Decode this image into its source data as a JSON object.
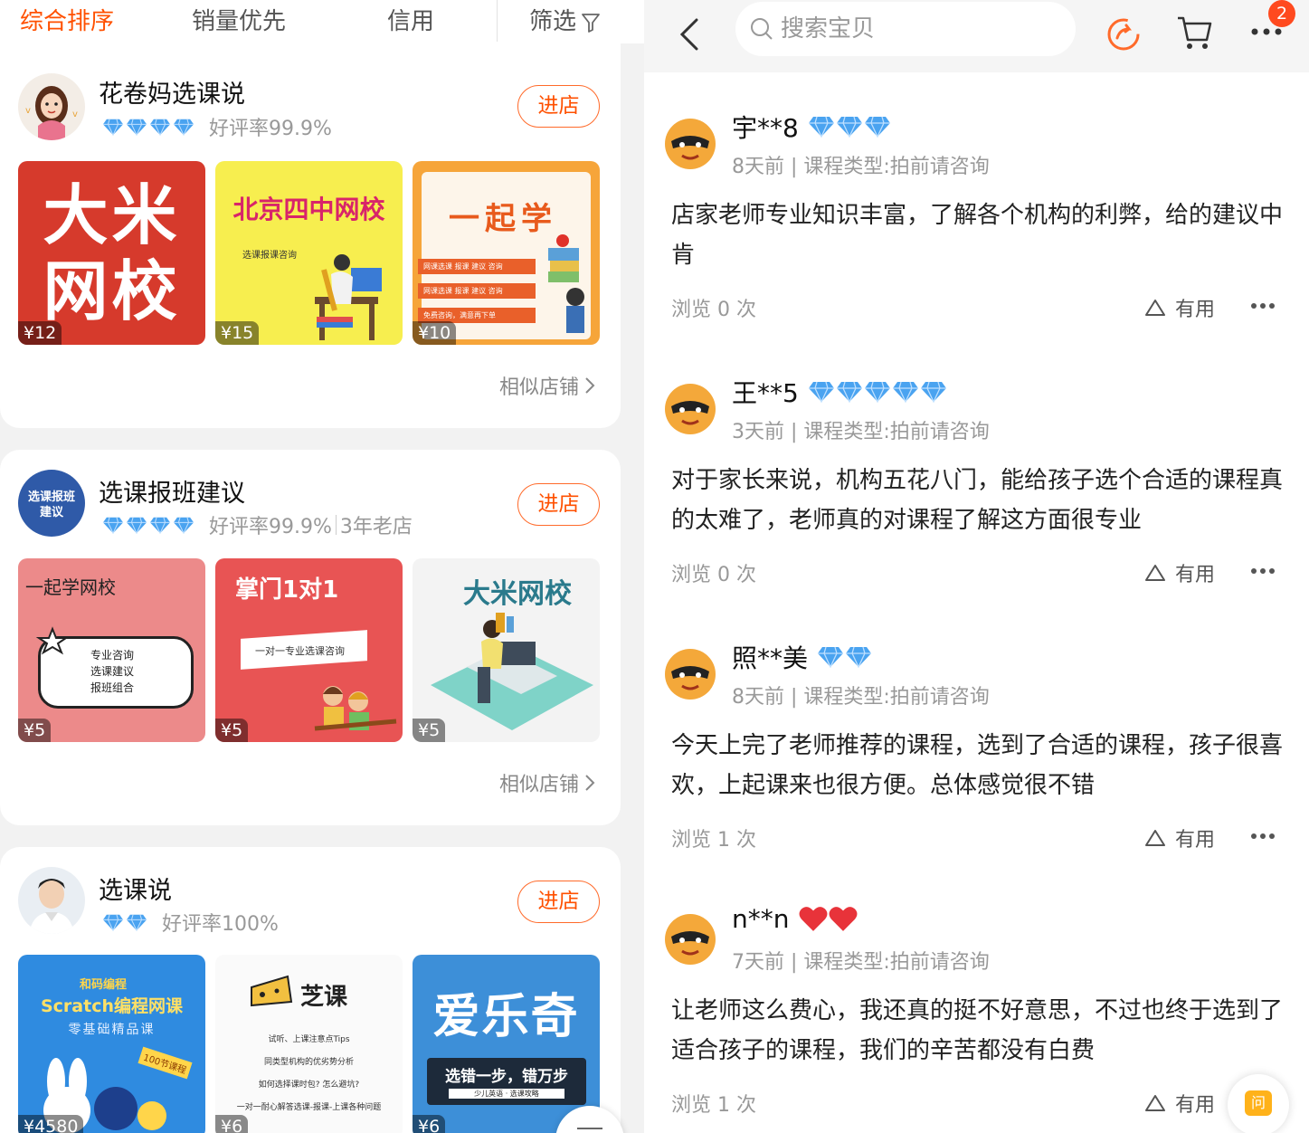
{
  "sort_tabs": [
    "综合排序",
    "销量优先",
    "信用",
    "筛选"
  ],
  "enter_label": "进店",
  "similar_label": "相似店铺",
  "shops": [
    {
      "name": "花卷妈选课说",
      "rating": "好评率99.9%",
      "age": "",
      "diamonds": 4,
      "products": [
        {
          "price": "¥12",
          "title_line1": "大米",
          "title_line2": "网校"
        },
        {
          "price": "¥15",
          "title": "北京四中网校",
          "subtitle": "选课报课咨询"
        },
        {
          "price": "¥10",
          "title": "一起学",
          "lines": [
            "网课选课 报课 建议 咨询",
            "网课选课 报课 建议 咨询",
            "免费咨询，满意再下单"
          ]
        }
      ]
    },
    {
      "name": "选课报班建议",
      "rating": "好评率99.9%",
      "age": "3年老店",
      "diamonds": 4,
      "avatar_text": [
        "选课报班",
        "建议"
      ],
      "products": [
        {
          "price": "¥5",
          "title": "一起学网校",
          "lines": [
            "专业咨询",
            "选课建议",
            "报班组合"
          ]
        },
        {
          "price": "¥5",
          "title": "掌门1对1",
          "subtitle": "一对一专业选课咨询"
        },
        {
          "price": "¥5",
          "title": "大米网校"
        }
      ]
    },
    {
      "name": "选课说",
      "rating": "好评率100%",
      "age": "",
      "diamonds": 2,
      "products": [
        {
          "price": "¥4580",
          "brand": "和码编程",
          "title": "Scratch编程网课",
          "subtitle": "零基础精品课",
          "tag": "100节课程"
        },
        {
          "price": "¥6",
          "title": "芝课",
          "lines": [
            "试听、上课注意点Tips",
            "同类型机构的优劣势分析",
            "如何选择课时包? 怎么避坑?",
            "一对一耐心解答选课-报课-上课各种问题"
          ]
        },
        {
          "price": "¥6",
          "title": "爱乐奇",
          "subtitle": "选错一步，错万步",
          "subtitle2": "少儿英语 · 选课攻略"
        }
      ]
    }
  ],
  "search": {
    "placeholder": "搜索宝贝"
  },
  "cart_badge": "2",
  "useful_label": "有用",
  "reviews": [
    {
      "user": "宇**8",
      "gem_type": "diamond",
      "gems": 3,
      "meta": "8天前 | 课程类型:拍前请咨询",
      "text": "店家老师专业知识丰富，了解各个机构的利弊，给的建议中肯",
      "views": "浏览 0 次"
    },
    {
      "user": "王**5",
      "gem_type": "diamond",
      "gems": 5,
      "meta": "3天前 | 课程类型:拍前请咨询",
      "text": "对于家长来说，机构五花八门，能给孩子选个合适的课程真的太难了，老师真的对课程了解这方面很专业",
      "views": "浏览 0 次"
    },
    {
      "user": "照**美",
      "gem_type": "diamond",
      "gems": 2,
      "meta": "8天前 | 课程类型:拍前请咨询",
      "text": "今天上完了老师推荐的课程，选到了合适的课程，孩子很喜欢，上起课来也很方便。总体感觉很不错",
      "views": "浏览 1 次"
    },
    {
      "user": "n**n",
      "gem_type": "heart",
      "gems": 2,
      "meta": "7天前 | 课程类型:拍前请咨询",
      "text": "让老师这么费心，我还真的挺不好意思，不过也终于选到了适合孩子的课程，我们的辛苦都没有白费",
      "views": "浏览 1 次"
    }
  ],
  "ask_label": "问",
  "colors": {
    "accent": "#ff5000",
    "diamond": "#4aa3f0",
    "heart": "#e8333a"
  }
}
